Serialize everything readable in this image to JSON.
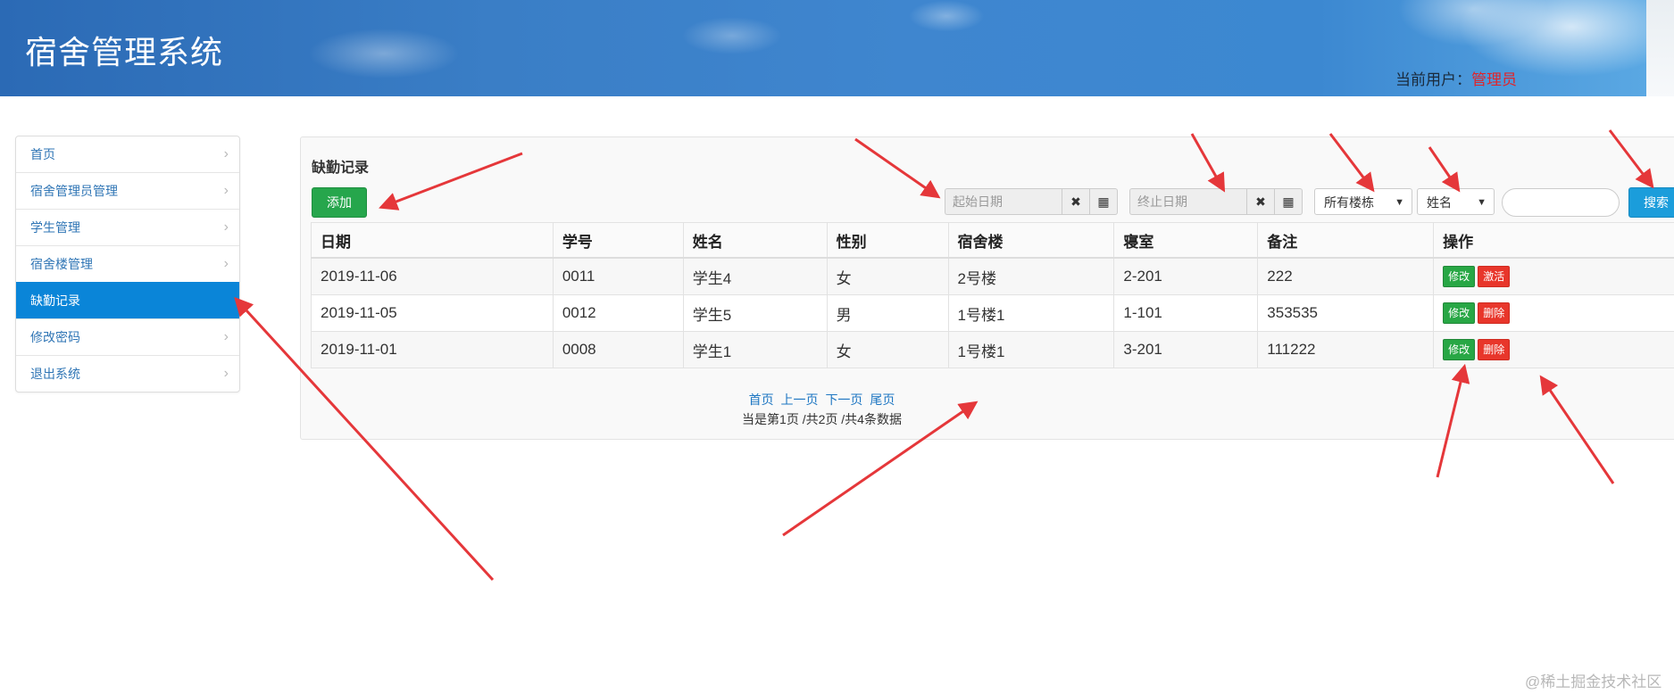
{
  "header": {
    "title": "宿舍管理系统",
    "current_user_label": "当前用户：",
    "current_user_name": "管理员"
  },
  "sidebar": {
    "items": [
      {
        "label": "首页"
      },
      {
        "label": "宿舍管理员管理"
      },
      {
        "label": "学生管理"
      },
      {
        "label": "宿舍楼管理"
      },
      {
        "label": "缺勤记录",
        "active": true
      },
      {
        "label": "修改密码"
      },
      {
        "label": "退出系统"
      }
    ]
  },
  "panel": {
    "title": "缺勤记录",
    "add_label": "添加",
    "start_date_placeholder": "起始日期",
    "end_date_placeholder": "终止日期",
    "building_select": "所有楼栋",
    "field_select": "姓名",
    "search_label": "搜索"
  },
  "table": {
    "headers": [
      "日期",
      "学号",
      "姓名",
      "性别",
      "宿舍楼",
      "寝室",
      "备注",
      "操作"
    ],
    "rows": [
      {
        "date": "2019-11-06",
        "id": "0011",
        "name": "学生4",
        "gender": "女",
        "building": "2号楼",
        "room": "2-201",
        "note": "222",
        "edit": "修改",
        "action": "激活"
      },
      {
        "date": "2019-11-05",
        "id": "0012",
        "name": "学生5",
        "gender": "男",
        "building": "1号楼1",
        "room": "1-101",
        "note": "353535",
        "edit": "修改",
        "action": "删除"
      },
      {
        "date": "2019-11-01",
        "id": "0008",
        "name": "学生1",
        "gender": "女",
        "building": "1号楼1",
        "room": "3-201",
        "note": "111222",
        "edit": "修改",
        "action": "删除"
      }
    ]
  },
  "pager": {
    "first": "首页",
    "prev": "上一页",
    "next": "下一页",
    "last": "尾页",
    "info": "当是第1页 /共2页  /共4条数据"
  },
  "watermark": "@稀土掘金技术社区",
  "colors": {
    "accent": "#0a85d8",
    "add_green": "#26a64c",
    "search_blue": "#1b9ddb",
    "delete_red": "#e8362b",
    "annotation_arrow": "#e5373a"
  },
  "icons": {
    "clear": "close-icon",
    "calendar": "grid-calendar-icon",
    "chevron": "chevron-right-icon",
    "caret": "chevron-down-icon"
  }
}
